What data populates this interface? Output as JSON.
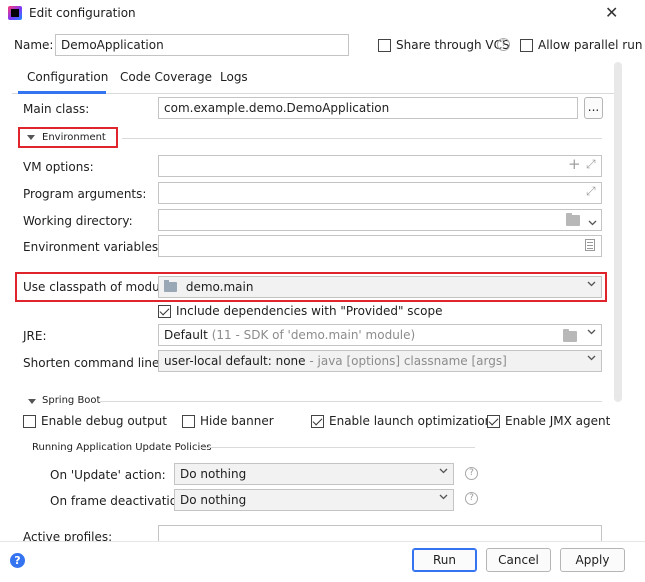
{
  "window": {
    "title": "Edit configuration",
    "close_glyph": "✕"
  },
  "name_row": {
    "label": "Name:",
    "value": "DemoApplication",
    "share_vcs_label": "Share through VCS",
    "allow_parallel_label": "Allow parallel run"
  },
  "tabs": [
    {
      "label": "Configuration",
      "active": true
    },
    {
      "label": "Code Coverage",
      "active": false
    },
    {
      "label": "Logs",
      "active": false
    }
  ],
  "main_class": {
    "label": "Main class:",
    "value": "com.example.demo.DemoApplication",
    "browse_label": "..."
  },
  "environment": {
    "label": "Environment",
    "vm_options": {
      "label": "VM options:",
      "value": ""
    },
    "program_arguments": {
      "label": "Program arguments:",
      "value": ""
    },
    "working_directory": {
      "label": "Working directory:",
      "value": ""
    },
    "environment_variables": {
      "label": "Environment variables:",
      "value": ""
    }
  },
  "classpath": {
    "label": "Use classpath of module:",
    "value": "demo.main"
  },
  "include_deps": {
    "label": "Include dependencies with \"Provided\" scope",
    "checked": true
  },
  "jre": {
    "label": "JRE:",
    "value": "Default",
    "hint": "(11 - SDK of 'demo.main' module)"
  },
  "shorten": {
    "label": "Shorten command line:",
    "value": "user-local default: none",
    "hint": "- java [options] classname [args]"
  },
  "spring_boot": {
    "label": "Spring Boot",
    "debug_output": {
      "label": "Enable debug output",
      "checked": false
    },
    "hide_banner": {
      "label": "Hide banner",
      "checked": false
    },
    "launch_opt": {
      "label": "Enable launch optimization",
      "checked": true
    },
    "jmx_agent": {
      "label": "Enable JMX agent",
      "checked": true
    },
    "update_policies_label": "Running Application Update Policies",
    "on_update": {
      "label": "On 'Update' action:",
      "value": "Do nothing"
    },
    "on_frame": {
      "label": "On frame deactivation:",
      "value": "Do nothing"
    },
    "active_profiles_label": "Active profiles:"
  },
  "footer": {
    "run_label": "Run",
    "cancel_label": "Cancel",
    "apply_label": "Apply",
    "help_glyph": "?"
  },
  "colors": {
    "accent": "#3574f0",
    "highlight": "#e0242c"
  }
}
